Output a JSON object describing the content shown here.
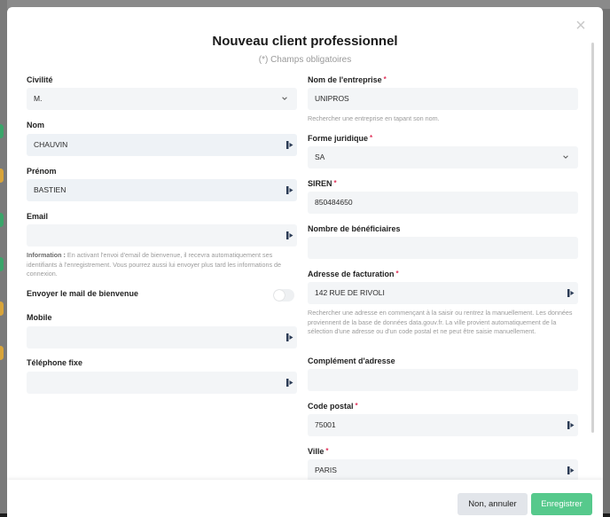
{
  "modal": {
    "title": "Nouveau client professionnel",
    "subtitle": "(*) Champs obligatoires",
    "close_glyph": "×"
  },
  "left": {
    "civilite": {
      "label": "Civilité",
      "value": "M.",
      "icon": "chevron-down-icon"
    },
    "nom": {
      "label": "Nom",
      "value": "CHAUVIN",
      "icon": "contact-card-icon"
    },
    "prenom": {
      "label": "Prénom",
      "value": "BASTIEN",
      "icon": "contact-card-icon"
    },
    "email": {
      "label": "Email",
      "value": "",
      "icon": "contact-card-icon"
    },
    "email_hint_bold": "Information :",
    "email_hint": " En activant l'envoi d'email de bienvenue, il recevra automatiquement ses identifiants à l'enregistrement. Vous pourrez aussi lui envoyer plus tard les informations de connexion.",
    "welcome": {
      "label": "Envoyer le mail de bienvenue",
      "checked": false
    },
    "mobile": {
      "label": "Mobile",
      "value": "",
      "icon": "contact-card-icon"
    },
    "fixe": {
      "label": "Téléphone fixe",
      "value": "",
      "icon": "contact-card-icon"
    }
  },
  "right": {
    "entreprise": {
      "label": "Nom de l'entreprise",
      "required": "*",
      "value": "UNIPROS",
      "hint": "Rechercher une entreprise en tapant son nom."
    },
    "forme": {
      "label": "Forme juridique",
      "required": "*",
      "value": "SA",
      "icon": "chevron-down-icon"
    },
    "siren": {
      "label": "SIREN",
      "required": "*",
      "value": "850484650"
    },
    "beneficiaires": {
      "label": "Nombre de bénéficiaires",
      "value": ""
    },
    "adresse": {
      "label": "Adresse de facturation",
      "required": "*",
      "value": "142 RUE DE RIVOLI",
      "icon": "contact-card-icon",
      "hint": "Rechercher une adresse en commençant à la saisir ou rentrez la manuellement. Les données proviennent de la base de données data.gouv.fr. La ville provient automatiquement de la sélection d'une adresse ou d'un code postal et ne peut être saisie manuellement."
    },
    "complement": {
      "label": "Complément d'adresse",
      "value": ""
    },
    "code_postal": {
      "label": "Code postal",
      "required": "*",
      "value": "75001",
      "icon": "contact-card-icon"
    },
    "ville": {
      "label": "Ville",
      "required": "*",
      "value": "PARIS",
      "icon": "contact-card-icon"
    }
  },
  "footer": {
    "cancel_label": "Non, annuler",
    "save_label": "Enregistrer"
  },
  "colors": {
    "accent_green": "#56c98c",
    "required_red": "#e0335a",
    "field_bg": "#f3f5f7"
  }
}
